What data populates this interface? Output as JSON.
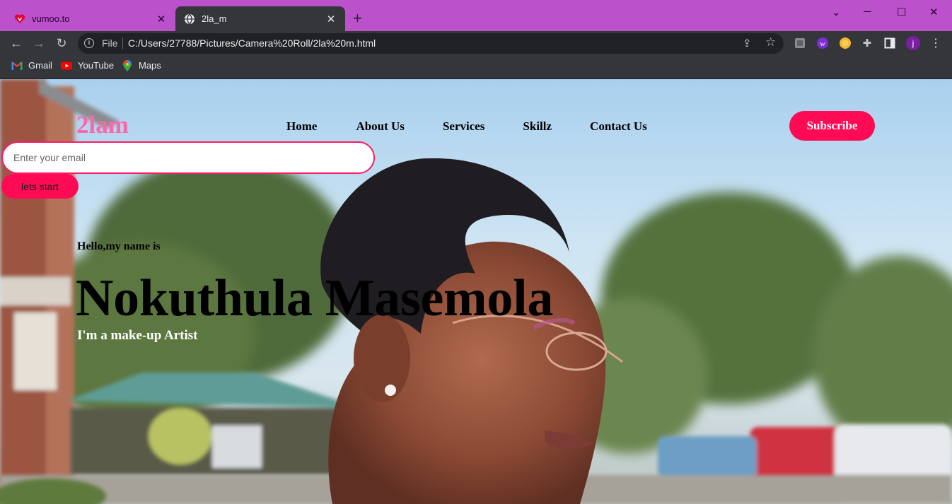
{
  "browser": {
    "tabs": [
      {
        "title": "vumoo.to",
        "icon": "vumoo-heart-icon",
        "active": false
      },
      {
        "title": "2la_m",
        "icon": "globe-icon",
        "active": true
      }
    ],
    "address": {
      "scheme_label": "File",
      "url": "C:/Users/27788/Pictures/Camera%20Roll/2la%20m.html"
    },
    "bookmarks": [
      {
        "label": "Gmail",
        "icon": "gmail-icon"
      },
      {
        "label": "YouTube",
        "icon": "youtube-icon"
      },
      {
        "label": "Maps",
        "icon": "maps-pin-icon"
      }
    ],
    "profile_initial": "j",
    "colors": {
      "tabstrip": "#bb52cc",
      "toolbar": "#35363a"
    }
  },
  "page": {
    "brand": "2lam",
    "nav": [
      "Home",
      "About Us",
      "Services",
      "Skillz",
      "Contact Us"
    ],
    "subscribe_label": "Subscribe",
    "email_placeholder": "Enter your email",
    "start_label": "lets start",
    "greeting": "Hello,my name is",
    "name": "Nokuthula Masemola",
    "tagline": "I'm a make-up Artist",
    "colors": {
      "accent": "#ff0a55",
      "brand": "#ff66a8"
    }
  }
}
